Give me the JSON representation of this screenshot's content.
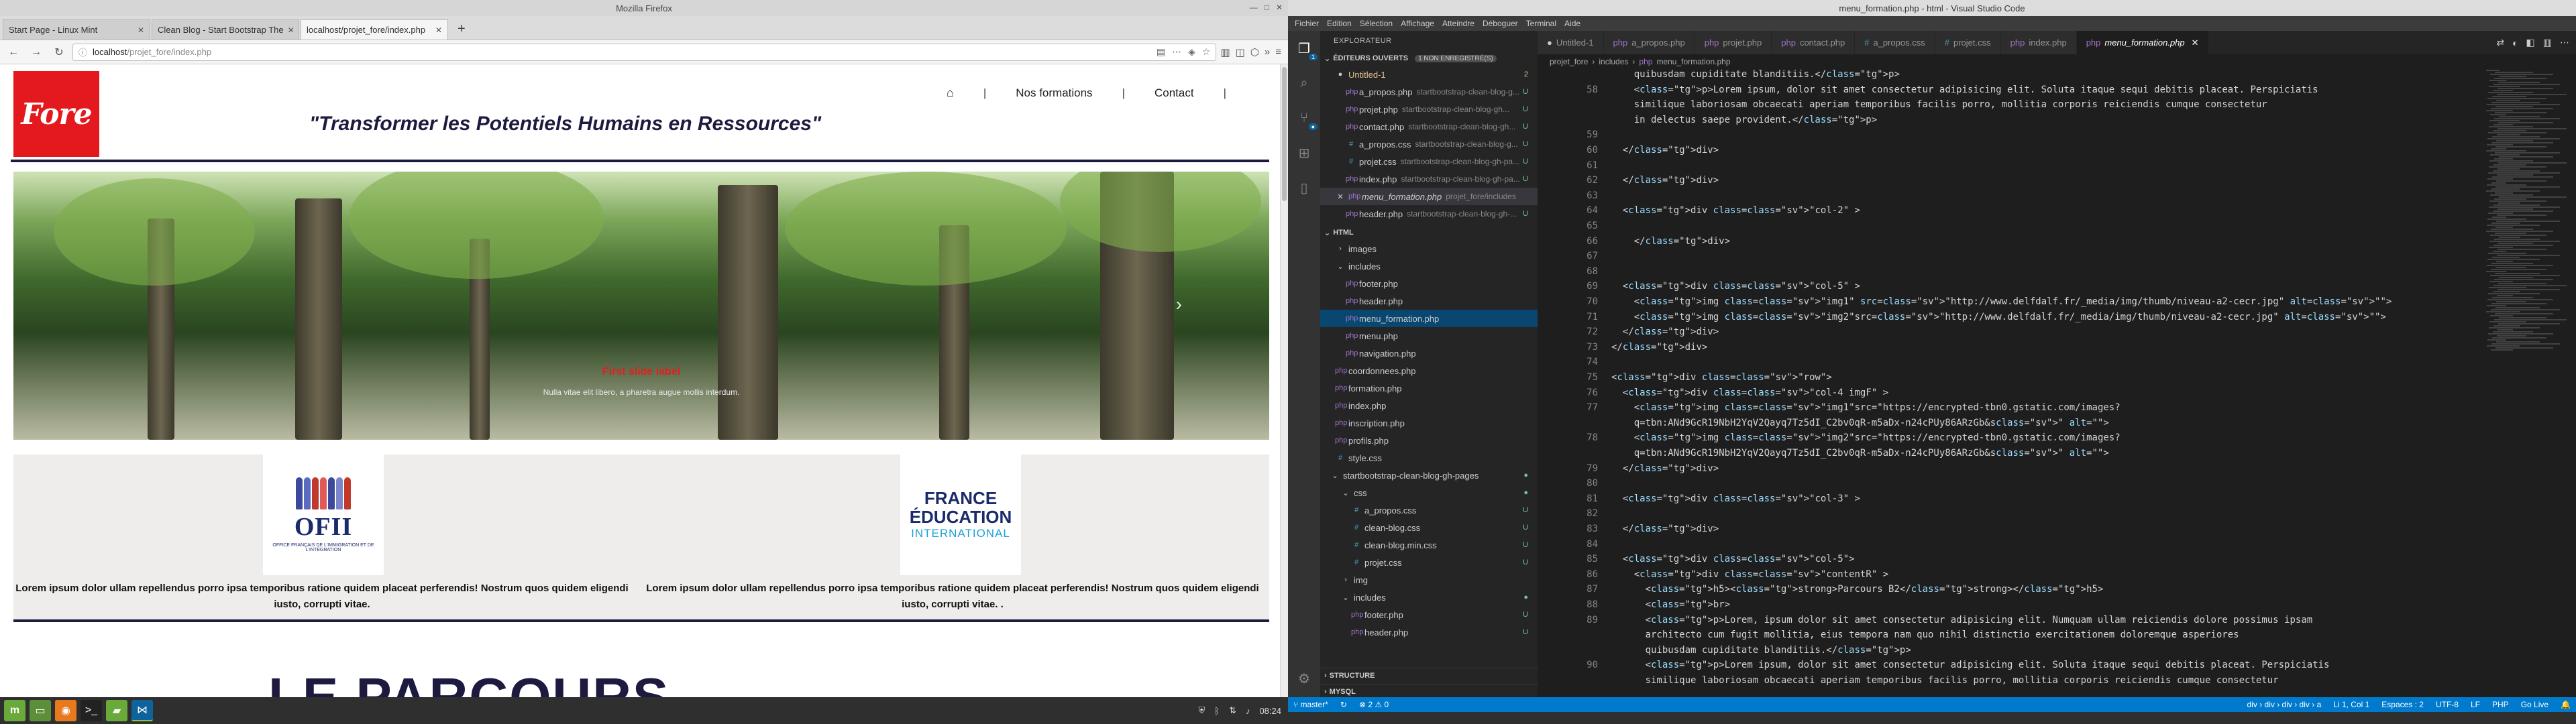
{
  "firefox": {
    "window_title": "Mozilla Firefox",
    "tabs": [
      {
        "label": "Start Page - Linux Mint"
      },
      {
        "label": "Clean Blog - Start Bootstrap The"
      },
      {
        "label": "localhost/projet_fore/index.php"
      }
    ],
    "url_host": "localhost",
    "url_path": "/projet_fore/index.php",
    "site": {
      "logo_text": "Fore",
      "tagline": "\"Transformer les Potentiels Humains en Ressources\"",
      "nav": [
        {
          "label": "Nos formations"
        },
        {
          "label": "Contact"
        }
      ],
      "hero_caption": "First slide label",
      "hero_sub": "Nulla vitae elit libero, a pharetra augue mollis interdum.",
      "card1_logo_text": "OFII",
      "card1_logo_sub": "OFFICE FRANÇAIS DE L'IMMIGRATION ET DE L'INTÉGRATION",
      "card2_logo_l1": "FRANCE",
      "card2_logo_l2": "ÉDUCATION",
      "card2_logo_l3": "INTERNATIONAL",
      "card1_text": "Lorem ipsum dolor ullam repellendus porro ipsa temporibus ratione quidem placeat perferendis! Nostrum quos quidem eligendi iusto, corrupti vitae.",
      "card2_text": "Lorem ipsum dolor ullam repellendus porro ipsa temporibus ratione quidem placeat perferendis! Nostrum quos quidem eligendi iusto, corrupti vitae. .",
      "section_title": "LE PARCOURS"
    }
  },
  "vscode": {
    "window_title": "menu_formation.php - html - Visual Studio Code",
    "menu": [
      "Fichier",
      "Edition",
      "Sélection",
      "Affichage",
      "Atteindre",
      "Déboguer",
      "Terminal",
      "Aide"
    ],
    "explorer_title": "EXPLORATEUR",
    "open_editors_label": "ÉDITEURS OUVERTS",
    "open_editors_count": "1 NON ENREGISTRÉ(S)",
    "open_editors": [
      {
        "name": "Untitled-1",
        "path": "",
        "status": "2"
      },
      {
        "name": "a_propos.php",
        "path": "startbootstrap-clean-blog-g...",
        "status": "U"
      },
      {
        "name": "projet.php",
        "path": "startbootstrap-clean-blog-gh...",
        "status": "U"
      },
      {
        "name": "contact.php",
        "path": "startbootstrap-clean-blog-gh...",
        "status": "U"
      },
      {
        "name": "a_propos.css",
        "path": "startbootstrap-clean-blog-g...",
        "status": "U"
      },
      {
        "name": "projet.css",
        "path": "startbootstrap-clean-blog-gh-pa...",
        "status": "U"
      },
      {
        "name": "index.php",
        "path": "startbootstrap-clean-blog-gh-pa...",
        "status": "U"
      },
      {
        "name": "menu_formation.php",
        "path": "projet_fore/includes",
        "status": ""
      },
      {
        "name": "header.php",
        "path": "startbootstrap-clean-blog-gh-...",
        "status": "U"
      }
    ],
    "folder_label": "HTML",
    "tree": [
      {
        "name": "images",
        "kind": "folder"
      },
      {
        "name": "includes",
        "kind": "folder"
      },
      {
        "name": "footer.php",
        "kind": "php"
      },
      {
        "name": "header.php",
        "kind": "php"
      },
      {
        "name": "menu_formation.php",
        "kind": "php"
      },
      {
        "name": "menu.php",
        "kind": "php"
      },
      {
        "name": "navigation.php",
        "kind": "php"
      },
      {
        "name": "coordonnees.php",
        "kind": "php"
      },
      {
        "name": "formation.php",
        "kind": "php"
      },
      {
        "name": "index.php",
        "kind": "php"
      },
      {
        "name": "inscription.php",
        "kind": "php"
      },
      {
        "name": "profils.php",
        "kind": "php"
      },
      {
        "name": "style.css",
        "kind": "css"
      },
      {
        "name": "startbootstrap-clean-blog-gh-pages",
        "kind": "folder-mod"
      },
      {
        "name": "css",
        "kind": "folder-mod"
      },
      {
        "name": "a_propos.css",
        "kind": "css-u"
      },
      {
        "name": "clean-blog.css",
        "kind": "css-u"
      },
      {
        "name": "clean-blog.min.css",
        "kind": "css-u"
      },
      {
        "name": "projet.css",
        "kind": "css-u"
      },
      {
        "name": "img",
        "kind": "folder"
      },
      {
        "name": "includes",
        "kind": "folder-mod"
      },
      {
        "name": "footer.php",
        "kind": "php-u"
      },
      {
        "name": "header.php",
        "kind": "php-u"
      }
    ],
    "structure_label": "STRUCTURE",
    "mysql_label": "MYSQL",
    "tabs": [
      {
        "label": "Untitled-1"
      },
      {
        "label": "a_propos.php"
      },
      {
        "label": "projet.php"
      },
      {
        "label": "contact.php"
      },
      {
        "label": "a_propos.css"
      },
      {
        "label": "projet.css"
      },
      {
        "label": "index.php"
      },
      {
        "label": "menu_formation.php"
      }
    ],
    "breadcrumb": [
      "projet_fore",
      "includes",
      "menu_formation.php"
    ],
    "lines": [
      {
        "n": "",
        "t": "    quibusdam cupiditate blanditiis.</p>"
      },
      {
        "n": "58",
        "t": "    <p>Lorem ipsum, dolor sit amet consectetur adipisicing elit. Soluta itaque sequi debitis placeat. Perspiciatis"
      },
      {
        "n": "",
        "t": "    similique laboriosam obcaecati aperiam temporibus facilis porro, mollitia corporis reiciendis cumque consectetur"
      },
      {
        "n": "",
        "t": "    in delectus saepe provident.</p>"
      },
      {
        "n": "59",
        "t": ""
      },
      {
        "n": "60",
        "t": "  </div>"
      },
      {
        "n": "61",
        "t": ""
      },
      {
        "n": "62",
        "t": "  </div>"
      },
      {
        "n": "63",
        "t": ""
      },
      {
        "n": "64",
        "t": "  <div class=\"col-2\" >"
      },
      {
        "n": "65",
        "t": ""
      },
      {
        "n": "66",
        "t": "    </div>"
      },
      {
        "n": "67",
        "t": ""
      },
      {
        "n": "68",
        "t": ""
      },
      {
        "n": "69",
        "t": "  <div class=\"col-5\" >"
      },
      {
        "n": "70",
        "t": "    <img class=\"img1\" src=\"http://www.delfdalf.fr/_media/img/thumb/niveau-a2-cecr.jpg\" alt=\"\">"
      },
      {
        "n": "71",
        "t": "    <img class=\"img2\"src=\"http://www.delfdalf.fr/_media/img/thumb/niveau-a2-cecr.jpg\" alt=\"\">"
      },
      {
        "n": "72",
        "t": "  </div>"
      },
      {
        "n": "73",
        "t": "</div>"
      },
      {
        "n": "74",
        "t": ""
      },
      {
        "n": "75",
        "t": "<div class=\"row\">"
      },
      {
        "n": "76",
        "t": "  <div class=\"col-4 imgF\" >"
      },
      {
        "n": "77",
        "t": "    <img class=\"img1\"src=\"https://encrypted-tbn0.gstatic.com/images?"
      },
      {
        "n": "",
        "t": "    q=tbn:ANd9GcR19NbH2YqV2Qayq7Tz5dI_C2bv0qR-m5aDx-n24cPUy86ARzGb&s\" alt=\"\">"
      },
      {
        "n": "78",
        "t": "    <img class=\"img2\"src=\"https://encrypted-tbn0.gstatic.com/images?"
      },
      {
        "n": "",
        "t": "    q=tbn:ANd9GcR19NbH2YqV2Qayq7Tz5dI_C2bv0qR-m5aDx-n24cPUy86ARzGb&s\" alt=\"\">"
      },
      {
        "n": "79",
        "t": "  </div>"
      },
      {
        "n": "80",
        "t": ""
      },
      {
        "n": "81",
        "t": "  <div class=\"col-3\" >"
      },
      {
        "n": "82",
        "t": ""
      },
      {
        "n": "83",
        "t": "  </div>"
      },
      {
        "n": "84",
        "t": ""
      },
      {
        "n": "85",
        "t": "  <div class=\"col-5\">"
      },
      {
        "n": "86",
        "t": "    <div class=\"contentR\" >"
      },
      {
        "n": "87",
        "t": "      <h5><strong>Parcours B2</strong></h5>"
      },
      {
        "n": "88",
        "t": "      <br>"
      },
      {
        "n": "89",
        "t": "      <p>Lorem, ipsum dolor sit amet consectetur adipisicing elit. Numquam ullam reiciendis dolore possimus ipsam"
      },
      {
        "n": "",
        "t": "      architecto cum fugit mollitia, eius tempora nam quo nihil distinctio exercitationem doloremque asperiores"
      },
      {
        "n": "",
        "t": "      quibusdam cupiditate blanditiis.</p>"
      },
      {
        "n": "90",
        "t": "      <p>Lorem ipsum, dolor sit amet consectetur adipisicing elit. Soluta itaque sequi debitis placeat. Perspiciatis"
      },
      {
        "n": "",
        "t": "      similique laboriosam obcaecati aperiam temporibus facilis porro, mollitia corporis reiciendis cumque consectetur"
      }
    ],
    "status_branch": "master*",
    "status_sync": "↻",
    "status_problems": "⊗ 2  ⚠ 0",
    "status_right": [
      "div › div › div › div › a",
      "Li 1, Col 1",
      "Espaces : 2",
      "UTF-8",
      "LF",
      "PHP",
      "Go Live"
    ]
  },
  "taskbar": {
    "clock": "08:24"
  }
}
